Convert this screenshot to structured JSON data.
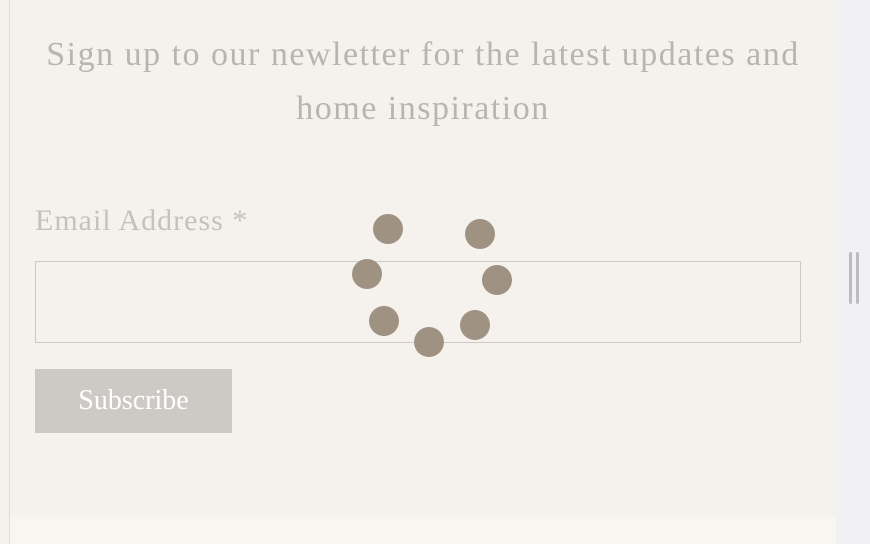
{
  "newsletter": {
    "heading_line1": "Sign up to our newletter for the latest updates and",
    "heading_line2": "home inspiration",
    "email_label": "Email Address",
    "required_marker": "*",
    "email_value": "",
    "subscribe_label": "Subscribe"
  },
  "loading": {
    "icon": "loading-spinner-icon",
    "color": "#a09282"
  },
  "colors": {
    "background": "#f5f2ed",
    "button": "#cdc9c4",
    "text_muted": "#b9b5ae"
  }
}
